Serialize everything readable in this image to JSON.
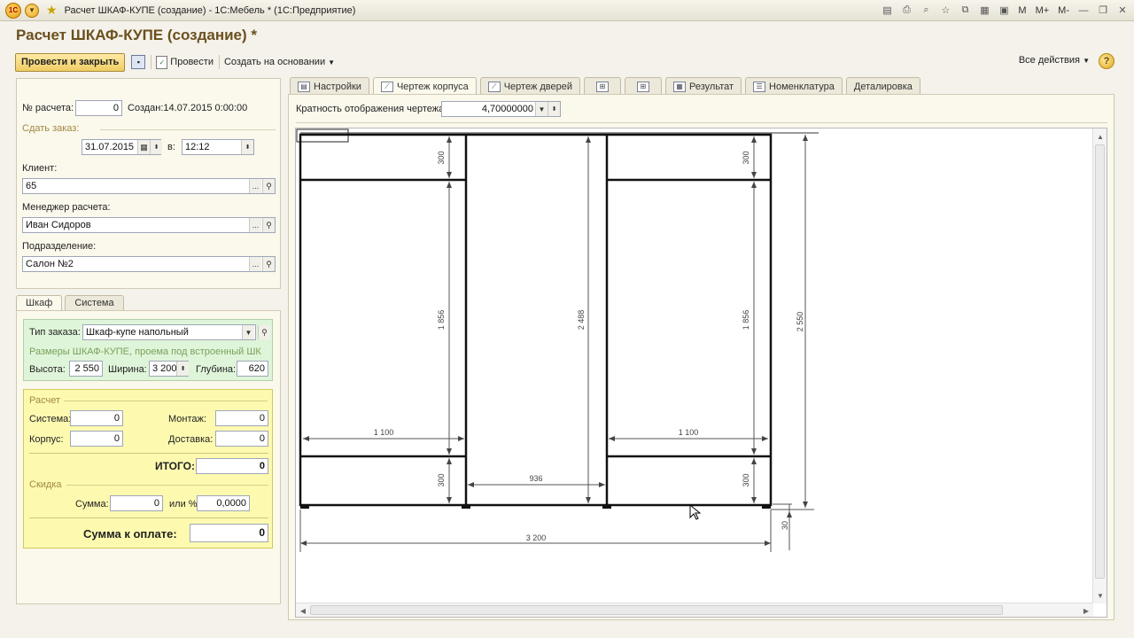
{
  "window": {
    "title": "Расчет ШКАФ-КУПЕ (создание) - 1С:Мебель * (1С:Предприятие)",
    "logo_text": "1С",
    "right_controls": [
      "M",
      "M+",
      "M-"
    ]
  },
  "form": {
    "title": "Расчет ШКАФ-КУПЕ (создание) *"
  },
  "toolbar": {
    "post_close_label": "Провести и закрыть",
    "post_label": "Провести",
    "create_based_label": "Создать на основании",
    "all_actions_label": "Все действия",
    "help_label": "?"
  },
  "header_fields": {
    "calc_no_label": "№ расчета:",
    "calc_no_value": "0",
    "created_text": "Создан:14.07.2015 0:00:00",
    "deliver_label": "Сдать заказ:",
    "deliver_date": "31.07.2015",
    "at_label": "в:",
    "deliver_time": "12:12",
    "client_label": "Клиент:",
    "client_value": "65",
    "manager_label": "Менеджер расчета:",
    "manager_value": "Иван Сидоров",
    "division_label": "Подразделение:",
    "division_value": "Салон №2",
    "ellipsis": "...",
    "search": "🔍"
  },
  "left_tabs": [
    "Шкаф",
    "Система"
  ],
  "wardrobe": {
    "order_type_label": "Тип заказа:",
    "order_type_value": "Шкаф-купе напольный",
    "sizes_label": "Размеры ШКАФ-КУПЕ, проема под встроенный ШК",
    "height_label": "Высота:",
    "height_value": "2 550",
    "width_label": "Ширина:",
    "width_value": "3 200",
    "depth_label": "Глубина:",
    "depth_value": "620"
  },
  "calc": {
    "section_label": "Расчет",
    "system_label": "Система:",
    "system_value": "0",
    "mount_label": "Монтаж:",
    "mount_value": "0",
    "body_label": "Корпус:",
    "body_value": "0",
    "delivery_label": "Доставка:",
    "delivery_value": "0",
    "total_label": "ИТОГО:",
    "total_value": "0",
    "discount_label": "Скидка",
    "sum_label": "Сумма:",
    "sum_value": "0",
    "or_pct_label": "или %:",
    "pct_value": "0,0000",
    "to_pay_label": "Сумма к оплате:",
    "to_pay_value": "0"
  },
  "right_tabs": [
    {
      "label": "Настройки",
      "icon": "settings-icon"
    },
    {
      "label": "Чертеж корпуса",
      "icon": "drawing-icon"
    },
    {
      "label": "Чертеж дверей",
      "icon": "drawing-icon"
    },
    {
      "label": "",
      "icon": "layout-icon"
    },
    {
      "label": "",
      "icon": "layout-icon"
    },
    {
      "label": "Результат",
      "icon": "table-icon"
    },
    {
      "label": "Номенклатура",
      "icon": "list-icon"
    },
    {
      "label": "Деталировка",
      "icon": ""
    }
  ],
  "drawing": {
    "scale_label": "Кратность отображения чертежа:",
    "scale_value": "4,70000000",
    "dims": {
      "top_left": "300",
      "mid_left": "1 856",
      "bottom_left": "300",
      "center_height": "2 488",
      "top_right": "300",
      "mid_right": "1 856",
      "bottom_right": "300",
      "total_height": "2 550",
      "shelf_left": "1 100",
      "shelf_right": "1 100",
      "middle_width": "936",
      "total_width": "3 200",
      "plinth": "30"
    }
  }
}
